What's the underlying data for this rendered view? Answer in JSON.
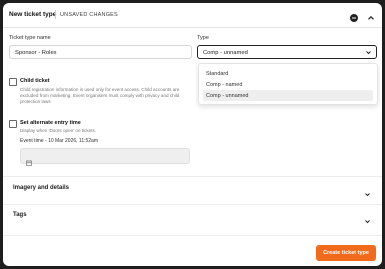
{
  "header": {
    "title": "New ticket type",
    "status": "UNSAVED CHANGES"
  },
  "form": {
    "name_label": "Ticket type name",
    "name_value": "Sponsor - Rolex",
    "type_label": "Type",
    "type_value": "Comp - unnamed",
    "type_options": [
      "Standard",
      "Comp - named",
      "Comp - unnamed"
    ],
    "child_ticket": {
      "title": "Child ticket",
      "desc_lines": [
        "Child registration information is used only for event access. Child accounts are",
        "excluded from marketing. Event organisers must comply with privacy and child",
        "protection laws"
      ],
      "checked": false
    },
    "alt_entry": {
      "title": "Set alternate entry time",
      "desc": "Display when 'Doors open' on tickets.",
      "event_time": "Event time - 10 Mar 2026, 11:52am",
      "checked": false
    }
  },
  "sections": {
    "imagery": "Imagery and details",
    "tags": "Tags"
  },
  "footer": {
    "create_label": "Create ticket type"
  },
  "colors": {
    "accent": "#f26b1d",
    "selected_option_bg": "#eeeeee"
  },
  "icons": [
    "minus-circle-icon",
    "chevron-up-icon",
    "chevron-down-icon",
    "calendar-icon"
  ]
}
